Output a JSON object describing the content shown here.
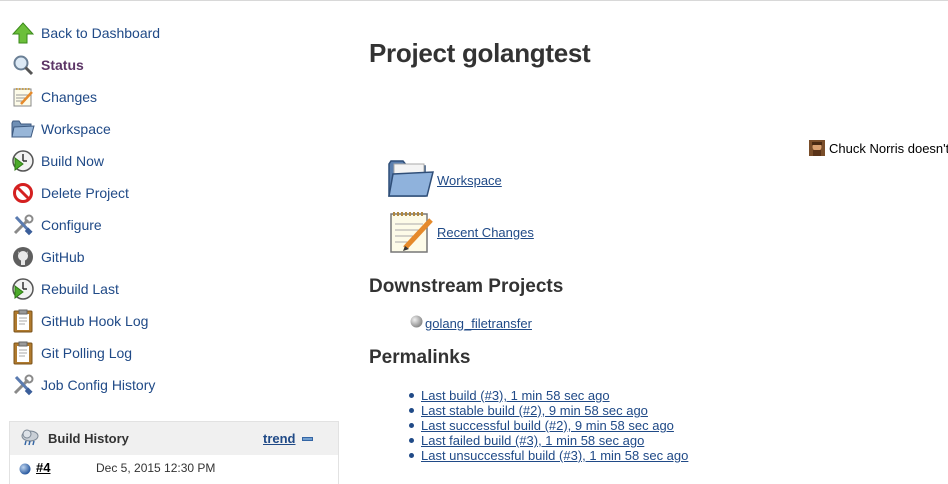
{
  "sidebar": {
    "tasks": [
      {
        "label": "Back to Dashboard",
        "icon": "up-arrow-icon"
      },
      {
        "label": "Status",
        "icon": "magnifier-icon"
      },
      {
        "label": "Changes",
        "icon": "notepad-icon"
      },
      {
        "label": "Workspace",
        "icon": "folder-icon"
      },
      {
        "label": "Build Now",
        "icon": "clock-play-icon"
      },
      {
        "label": "Delete Project",
        "icon": "no-entry-icon"
      },
      {
        "label": "Configure",
        "icon": "wrench-screwdriver-icon"
      },
      {
        "label": "GitHub",
        "icon": "github-icon"
      },
      {
        "label": "Rebuild Last",
        "icon": "clock-play-icon"
      },
      {
        "label": "GitHub Hook Log",
        "icon": "clipboard-icon"
      },
      {
        "label": "Git Polling Log",
        "icon": "clipboard-icon"
      },
      {
        "label": "Job Config History",
        "icon": "wrench-screwdriver-icon"
      }
    ]
  },
  "build_history": {
    "title": "Build History",
    "trend_label": "trend",
    "rows": [
      {
        "number": "#4",
        "date": "Dec 5, 2015 12:30 PM",
        "status_color": "#3465a4"
      }
    ]
  },
  "main": {
    "title": "Project golangtest",
    "quote": "Chuck Norris doesn't",
    "workspace_link": "Workspace",
    "recent_changes_link": "Recent Changes",
    "downstream_heading": "Downstream Projects",
    "downstream_projects": [
      {
        "name": "golang_filetransfer",
        "status_color": "#aaaaaa"
      }
    ],
    "permalinks_heading": "Permalinks",
    "permalinks": [
      "Last build (#3), 1 min 58 sec ago",
      "Last stable build (#2), 9 min 58 sec ago",
      "Last successful build (#2), 9 min 58 sec ago",
      "Last failed build (#3), 1 min 58 sec ago",
      "Last unsuccessful build (#3), 1 min 58 sec ago"
    ]
  },
  "colors": {
    "link": "#204a87",
    "visited": "#5c3566",
    "panel_header": "#f0f0f0"
  }
}
